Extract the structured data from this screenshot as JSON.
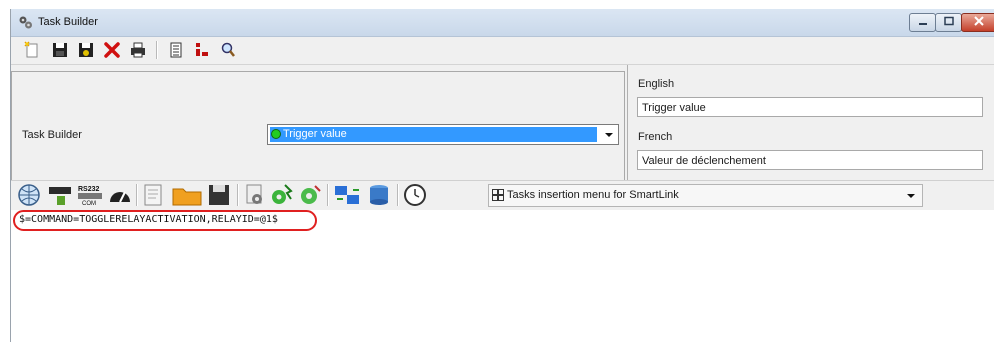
{
  "window": {
    "title": "Task Builder",
    "icon": "gear-cluster-icon"
  },
  "title_buttons": [
    "minimize-icon",
    "maximize-icon",
    "close-icon"
  ],
  "toolbar": {
    "icons": [
      "new-icon",
      "save-icon",
      "save-as-icon",
      "delete-icon",
      "print-icon",
      "list-icon",
      "tree-icon",
      "search-icon"
    ]
  },
  "properties": {
    "label": "Task Builder",
    "dropdown_value": "Trigger value"
  },
  "languages": [
    {
      "name": "English",
      "value": "Trigger value"
    },
    {
      "name": "French",
      "value": "Valeur de déclenchement"
    }
  ],
  "tasks_bar": {
    "menu_label": "Tasks insertion menu for SmartLink",
    "menu_icon": "grid-icon"
  },
  "editor": {
    "text": "$=COMMAND=TOGGLERELAYACTIVATION,RELAYID=@1$"
  },
  "colors": {
    "selection": "#3399ff",
    "highlight_ring": "#e02020",
    "titlebar": "#c9d8ea"
  }
}
